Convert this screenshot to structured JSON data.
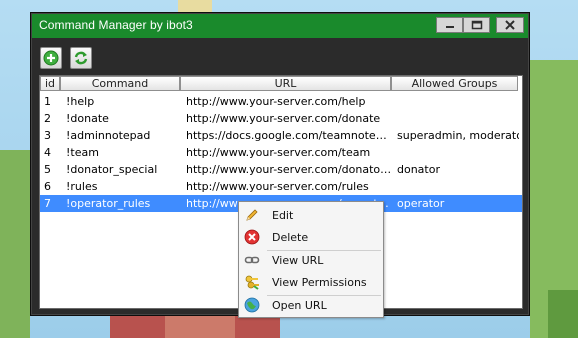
{
  "window": {
    "title": "Command Manager by ibot3"
  },
  "titlebar_buttons": [
    "minimize-icon",
    "maximize-icon",
    "close-icon"
  ],
  "toolbar": {
    "add_icon": "add-icon",
    "refresh_icon": "refresh-icon"
  },
  "table": {
    "columns": [
      "id",
      "Command",
      "URL",
      "Allowed Groups"
    ],
    "rows": [
      {
        "id": "1",
        "command": "!help",
        "url": "http://www.your-server.com/help",
        "groups": ""
      },
      {
        "id": "2",
        "command": "!donate",
        "url": "http://www.your-server.com/donate",
        "groups": ""
      },
      {
        "id": "3",
        "command": "!adminnotepad",
        "url": "https://docs.google.com/teamnotepad/...",
        "groups": "superadmin, moderator"
      },
      {
        "id": "4",
        "command": "!team",
        "url": "http://www.your-server.com/team",
        "groups": ""
      },
      {
        "id": "5",
        "command": "!donator_special",
        "url": "http://www.your-server.com/donatoronly",
        "groups": "donator"
      },
      {
        "id": "6",
        "command": "!rules",
        "url": "http://www.your-server.com/rules",
        "groups": ""
      },
      {
        "id": "7",
        "command": "!operator_rules",
        "url": "http://www.your-server.com/operator...",
        "groups": "operator"
      }
    ],
    "selected_row": 6
  },
  "context_menu": {
    "items": [
      {
        "label": "Edit",
        "icon": "pencil-icon"
      },
      {
        "label": "Delete",
        "icon": "delete-icon"
      },
      {
        "label": "View URL",
        "icon": "link-icon"
      },
      {
        "label": "View Permissions",
        "icon": "keys-icon"
      },
      {
        "label": "Open URL",
        "icon": "globe-icon"
      }
    ]
  },
  "colors": {
    "titlebar": "#1a8a2c",
    "selection": "#3f8cff",
    "window_body": "#2b2b2b"
  }
}
